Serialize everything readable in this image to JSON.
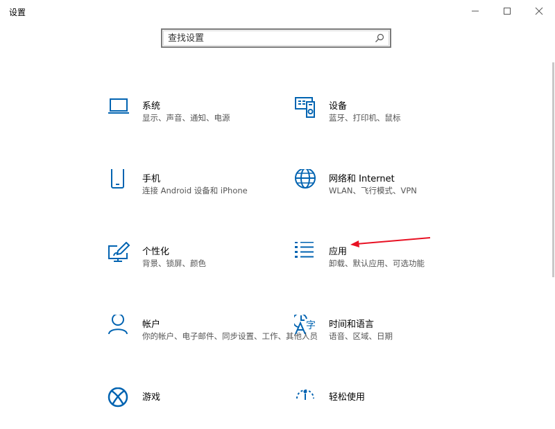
{
  "window": {
    "title": "设置"
  },
  "search": {
    "placeholder": "查找设置"
  },
  "tiles": [
    {
      "name": "系统",
      "desc": "显示、声音、通知、电源",
      "icon": "laptop-icon"
    },
    {
      "name": "设备",
      "desc": "蓝牙、打印机、鼠标",
      "icon": "devices-icon"
    },
    {
      "name": "手机",
      "desc": "连接 Android 设备和 iPhone",
      "icon": "phone-icon"
    },
    {
      "name": "网络和 Internet",
      "desc": "WLAN、飞行模式、VPN",
      "icon": "globe-icon"
    },
    {
      "name": "个性化",
      "desc": "背景、锁屏、颜色",
      "icon": "personalization-icon"
    },
    {
      "name": "应用",
      "desc": "卸载、默认应用、可选功能",
      "icon": "apps-list-icon"
    },
    {
      "name": "帐户",
      "desc": "你的帐户、电子邮件、同步设置、工作、其他人员",
      "icon": "person-icon"
    },
    {
      "name": "时间和语言",
      "desc": "语音、区域、日期",
      "icon": "time-language-icon"
    },
    {
      "name": "游戏",
      "desc": "",
      "icon": "xbox-icon"
    },
    {
      "name": "轻松使用",
      "desc": "",
      "icon": "ease-of-access-icon"
    }
  ],
  "colors": {
    "accent": "#0063b1",
    "annotation": "#e81123"
  }
}
